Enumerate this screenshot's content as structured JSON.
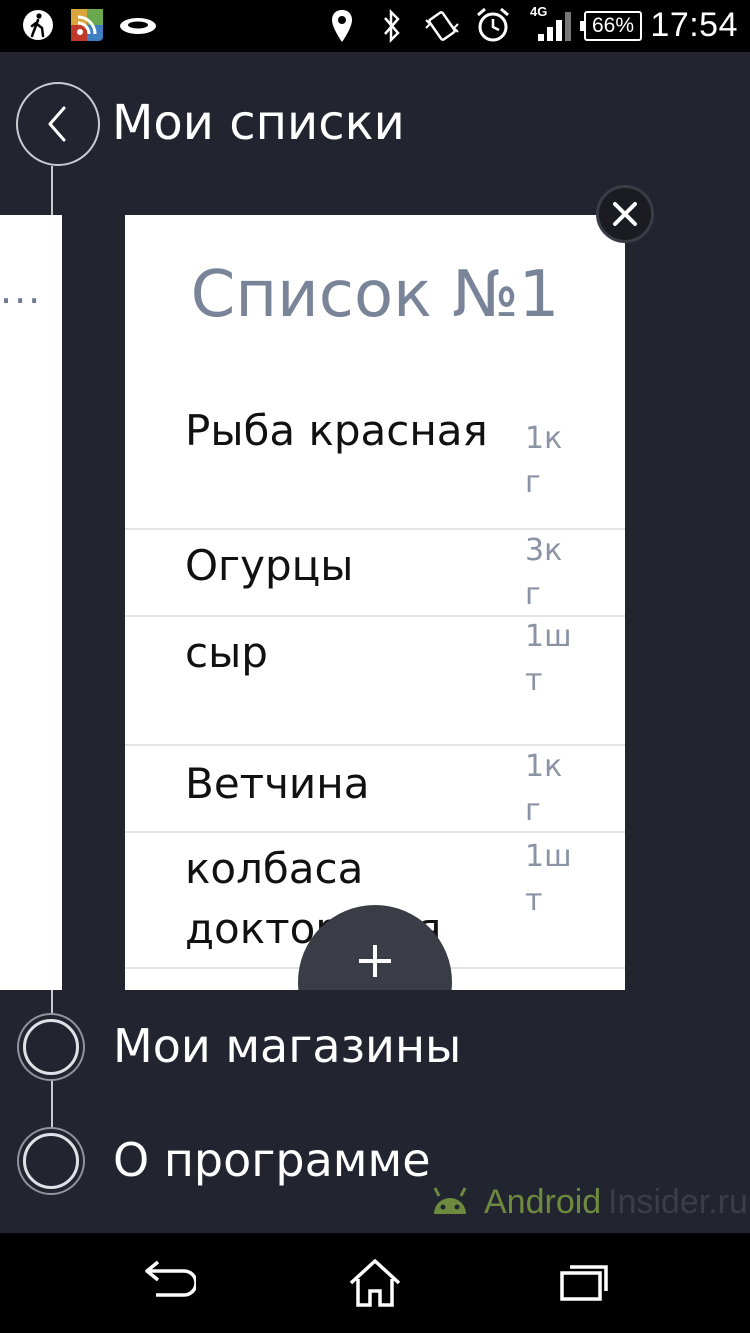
{
  "status_bar": {
    "time": "17:54",
    "battery": "66%",
    "network": "4G",
    "icons": [
      "walk-icon",
      "rss-icon",
      "disc-icon",
      "location-icon",
      "bluetooth-icon",
      "vibrate-icon",
      "alarm-icon",
      "signal-icon"
    ]
  },
  "header": {
    "title": "Мои списки"
  },
  "prev_card": {
    "ellipsis": "..."
  },
  "list_card": {
    "title": "Список №1",
    "items": [
      {
        "name": "Рыба красная",
        "qty": "1кг"
      },
      {
        "name": "Огурцы",
        "qty": "3кг"
      },
      {
        "name": "сыр",
        "qty": "1шт"
      },
      {
        "name": "Ветчина",
        "qty": "1кг"
      },
      {
        "name": "колбаса докторская",
        "qty": "1шт"
      }
    ]
  },
  "menu": {
    "items": [
      {
        "label": "Мои магазины"
      },
      {
        "label": "О программе"
      }
    ]
  },
  "watermark": {
    "brand": "Android",
    "suffix": "Insider.ru"
  },
  "colors": {
    "background": "#22252f",
    "card_title": "#7a8499",
    "watermark_green": "#6e8a3e"
  }
}
